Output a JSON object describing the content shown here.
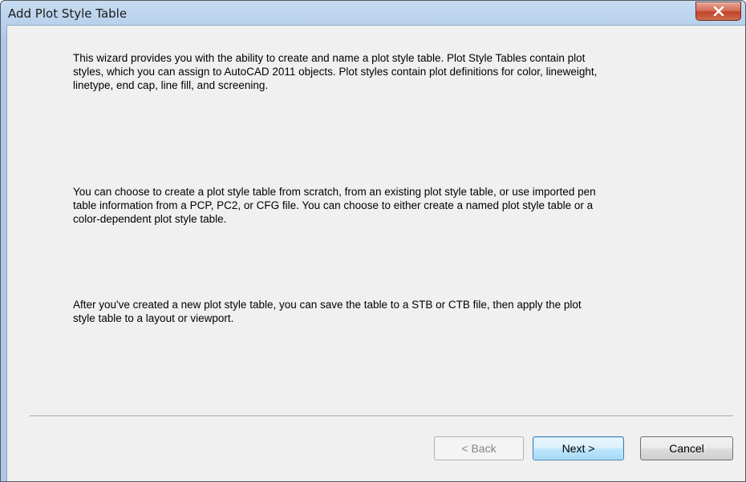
{
  "window": {
    "title": "Add Plot Style Table"
  },
  "content": {
    "paragraph1": "This wizard provides you with the ability to create and name a plot style table. Plot Style Tables contain plot styles, which you can assign to AutoCAD 2011 objects. Plot styles contain plot definitions for color, lineweight, linetype, end cap, line fill, and screening.",
    "paragraph2": "You can choose to create a plot style table from scratch, from an existing plot style table, or use imported pen table information from a PCP, PC2, or CFG file. You can choose to either create a named plot style table or a color-dependent plot style table.",
    "paragraph3": "After you've created a new plot style table, you can save the table to a STB or CTB file, then apply the plot style table to a layout or viewport."
  },
  "buttons": {
    "back": "< Back",
    "next": "Next >",
    "cancel": "Cancel"
  },
  "icons": {
    "close": "close-icon"
  },
  "colors": {
    "titlebar": "#b9d1ec",
    "client_background": "#f0f0f0",
    "close_button": "#c2452a",
    "default_button_border": "#3c7fb1"
  }
}
